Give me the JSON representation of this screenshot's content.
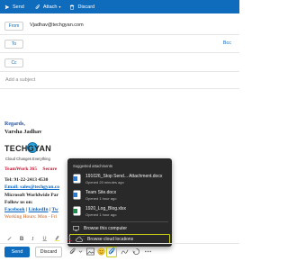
{
  "toolbar": {
    "send_label": "Send",
    "attach_label": "Attach",
    "discard_label": "Discard"
  },
  "compose": {
    "from_label": "From",
    "from_value": "Vjadhav@techgyan.com",
    "to_label": "To",
    "cc_label": "Cc",
    "bcc_label": "Bcc",
    "subject_placeholder": "Add a subject"
  },
  "signature": {
    "regards": "Regards,",
    "name": "Varsha Jadhav",
    "logo_text": "TECHGYAN",
    "logo_tagline": "Cloud Changes Everything",
    "teamwork": "TeamWork 365",
    "secure": "Secure",
    "tel": "Tel: 91-22-2413 4530",
    "email_line": "Email: sales@techgyan.co",
    "partner": "Microsoft Worldwide Par",
    "follow": "Follow us on:",
    "social_facebook": "Facebook",
    "social_linkedin": "LinkedIn",
    "social_twitter": "Tw",
    "hours": "Working Hours: Mon - Fri"
  },
  "attach_menu": {
    "header": "Suggested attachments",
    "items": [
      {
        "name": "191026_Stop Send... Attachment.docx",
        "time": "Opened 20 minutes ago",
        "color": "#2b7cd3"
      },
      {
        "name": "Team Site.docx",
        "time": "Opened 1 hour ago",
        "color": "#2b7cd3"
      },
      {
        "name": "1920_Log_Blog.xlsx",
        "time": "Opened 1 hour ago",
        "color": "#1e8e4f"
      }
    ],
    "browse_computer": "Browse this computer",
    "browse_cloud": "Browse cloud locations"
  },
  "footer": {
    "send_label": "Send",
    "discard_label": "Discard"
  },
  "colors": {
    "accent": "#0f6cbd",
    "menu_bg": "#292929",
    "highlight": "#c8cc14"
  }
}
